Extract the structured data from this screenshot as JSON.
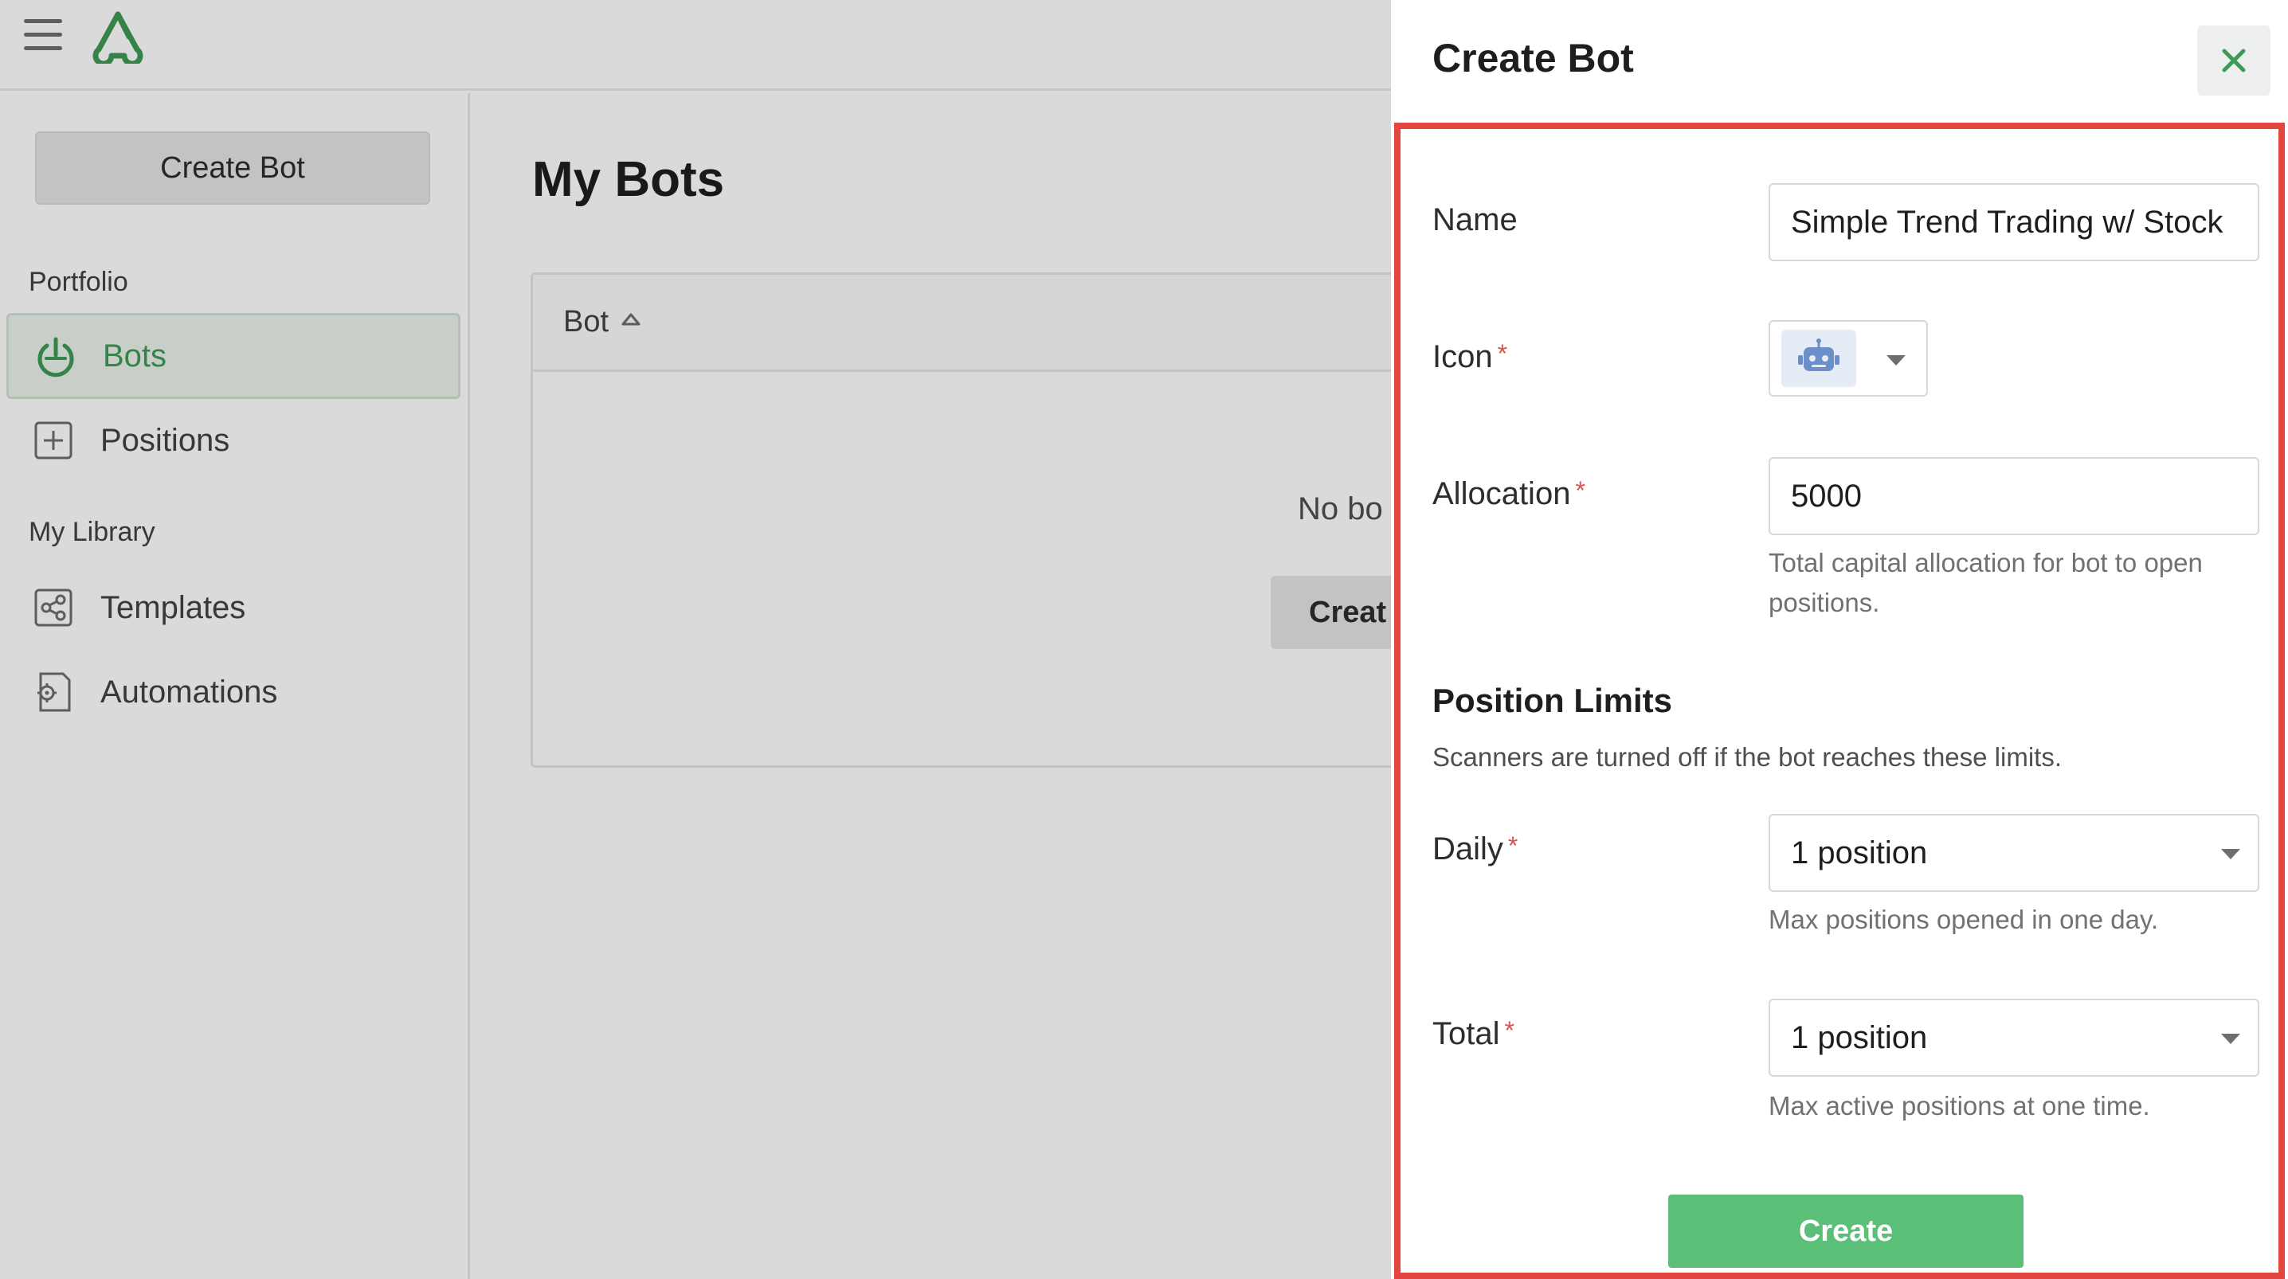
{
  "sidebar": {
    "create_button": "Create Bot",
    "portfolio_label": "Portfolio",
    "library_label": "My Library",
    "items": [
      {
        "label": "Bots",
        "icon": "power-icon",
        "active": true
      },
      {
        "label": "Positions",
        "icon": "plus-square-icon"
      },
      {
        "label": "Templates",
        "icon": "share-nodes-icon"
      },
      {
        "label": "Automations",
        "icon": "gear-document-icon"
      }
    ]
  },
  "main": {
    "title": "My Bots",
    "table": {
      "column_bot": "Bot",
      "empty_text": "No bo",
      "empty_button": "Creat"
    }
  },
  "panel": {
    "title": "Create Bot",
    "name": {
      "label": "Name",
      "value": "Simple Trend Trading w/ Stock"
    },
    "icon": {
      "label": "Icon",
      "required_mark": "*",
      "value": "robot-icon"
    },
    "allocation": {
      "label": "Allocation",
      "required_mark": "*",
      "value": "5000",
      "help": "Total capital allocation for bot to open positions."
    },
    "position_limits": {
      "title": "Position Limits",
      "description": "Scanners are turned off if the bot reaches these limits.",
      "daily": {
        "label": "Daily",
        "required_mark": "*",
        "value": "1 position",
        "help": "Max positions opened in one day."
      },
      "total": {
        "label": "Total",
        "required_mark": "*",
        "value": "1 position",
        "help": "Max active positions at one time."
      }
    },
    "submit": "Create"
  },
  "colors": {
    "accent_green": "#5cbf78",
    "active_green": "#3f9a56",
    "highlight_red": "#e2463f",
    "required_red": "#d9534f",
    "robot_blue": "#6b8fc9"
  }
}
